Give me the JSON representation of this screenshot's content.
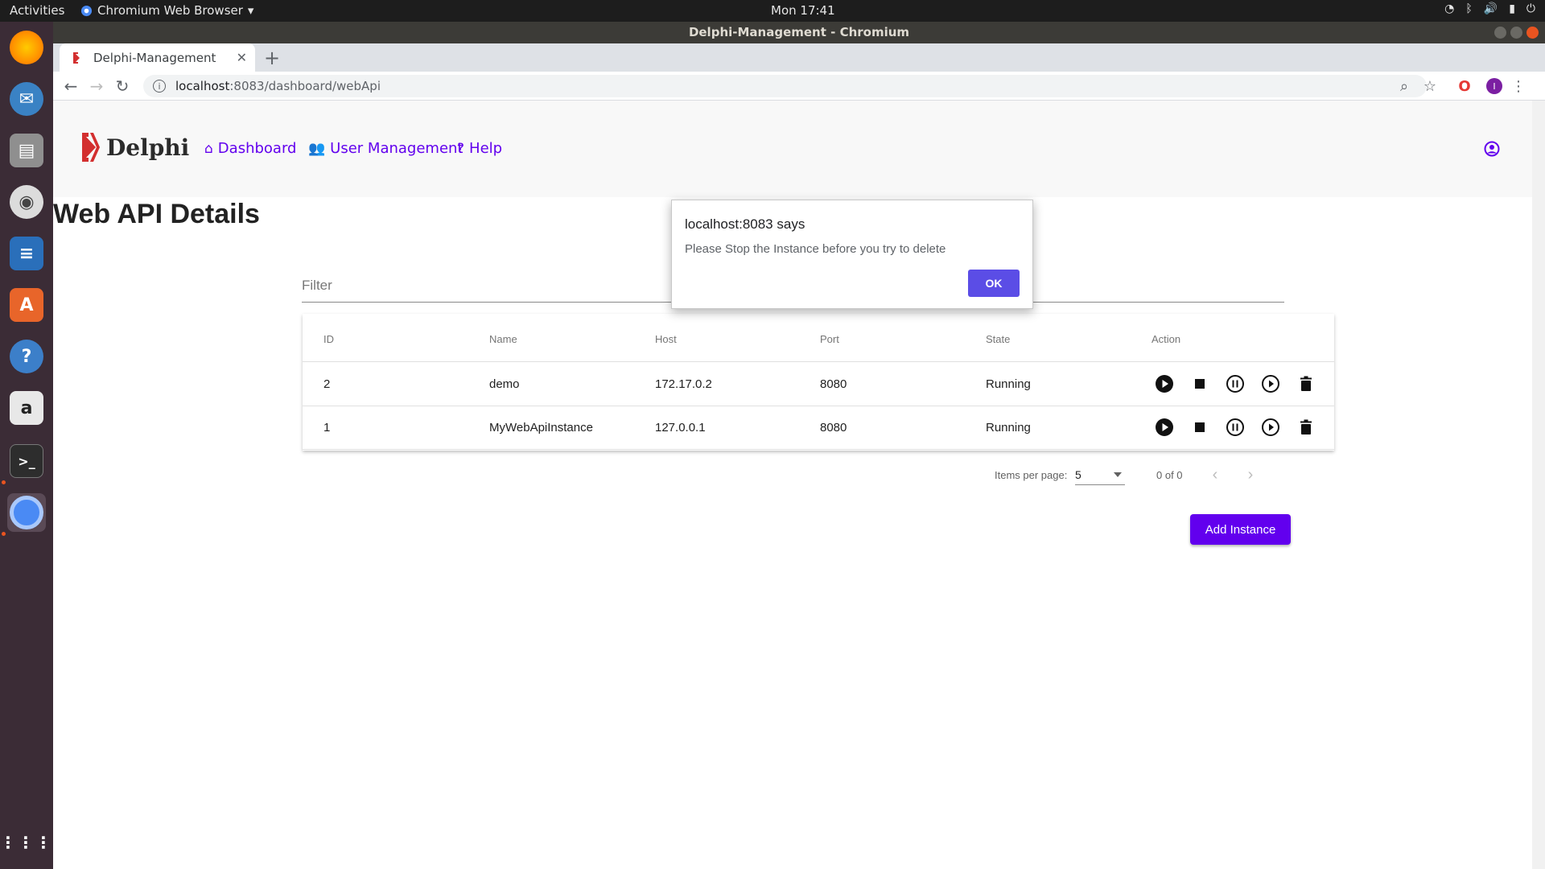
{
  "system": {
    "activities": "Activities",
    "app_menu": "Chromium Web Browser",
    "clock": "Mon 17:41"
  },
  "window": {
    "title": "Delphi-Management - Chromium"
  },
  "browser": {
    "tab_title": "Delphi-Management",
    "url_host": "localhost",
    "url_path": ":8083/dashboard/webApi",
    "profile_initial": "I"
  },
  "app": {
    "logo_text": "Delphi",
    "nav": {
      "dashboard": "Dashboard",
      "user_management": "User Management",
      "help": "Help"
    },
    "page_title": "Web API Details",
    "filter_placeholder": "Filter",
    "table": {
      "headers": [
        "ID",
        "Name",
        "Host",
        "Port",
        "State",
        "Action"
      ],
      "rows": [
        {
          "id": "2",
          "name": "demo",
          "host": "172.17.0.2",
          "port": "8080",
          "state": "Running"
        },
        {
          "id": "1",
          "name": "MyWebApiInstance",
          "host": "127.0.0.1",
          "port": "8080",
          "state": "Running"
        }
      ]
    },
    "paginator": {
      "items_per_page_label": "Items per page:",
      "page_size": "5",
      "range": "0 of 0"
    },
    "add_button": "Add Instance",
    "accent_color": "#6200ee"
  },
  "dialog": {
    "title": "localhost:8083 says",
    "message": "Please Stop the Instance before you try to delete",
    "ok": "OK"
  }
}
